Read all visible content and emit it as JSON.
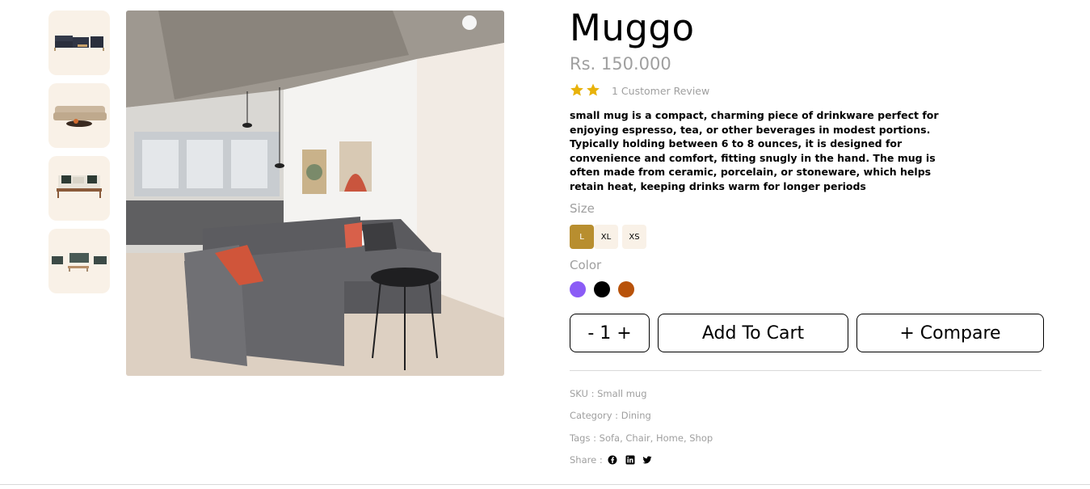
{
  "product": {
    "name": "Muggo",
    "price": "Rs. 150.000",
    "rating_stars": 2,
    "review_text": "1 Customer Review",
    "description": "small mug is a compact, charming piece of drinkware perfect for enjoying espresso, tea, or other beverages in modest portions. Typically holding between 6 to 8 ounces, it is designed for convenience and comfort, fitting snugly in the hand. The mug is often made from ceramic, porcelain, or stoneware, which helps retain heat, keeping drinks warm for longer periods"
  },
  "thumbnails": [
    {
      "icon": "sofa-set-thumbnail"
    },
    {
      "icon": "beige-sofa-thumbnail"
    },
    {
      "icon": "bench-sofa-thumbnail"
    },
    {
      "icon": "patio-set-thumbnail"
    }
  ],
  "size": {
    "label": "Size",
    "options": [
      "L",
      "XL",
      "XS"
    ],
    "selected": "L"
  },
  "color": {
    "label": "Color",
    "options": [
      "#8b5cf6",
      "#000000",
      "#b8520a"
    ]
  },
  "cart": {
    "quantity_label": "- 1 +",
    "add_to_cart": "Add To Cart",
    "compare": "+ Compare"
  },
  "meta": {
    "sku": "SKU : Small mug",
    "category": "Category : Dining",
    "tags": "Tags : Sofa, Chair, Home, Shop",
    "share": "Share :"
  },
  "colors": {
    "accent": "#b88e2f",
    "muted_text": "#9f9f9f",
    "thumb_bg": "#f9f1e7",
    "star": "#e8b20a"
  }
}
